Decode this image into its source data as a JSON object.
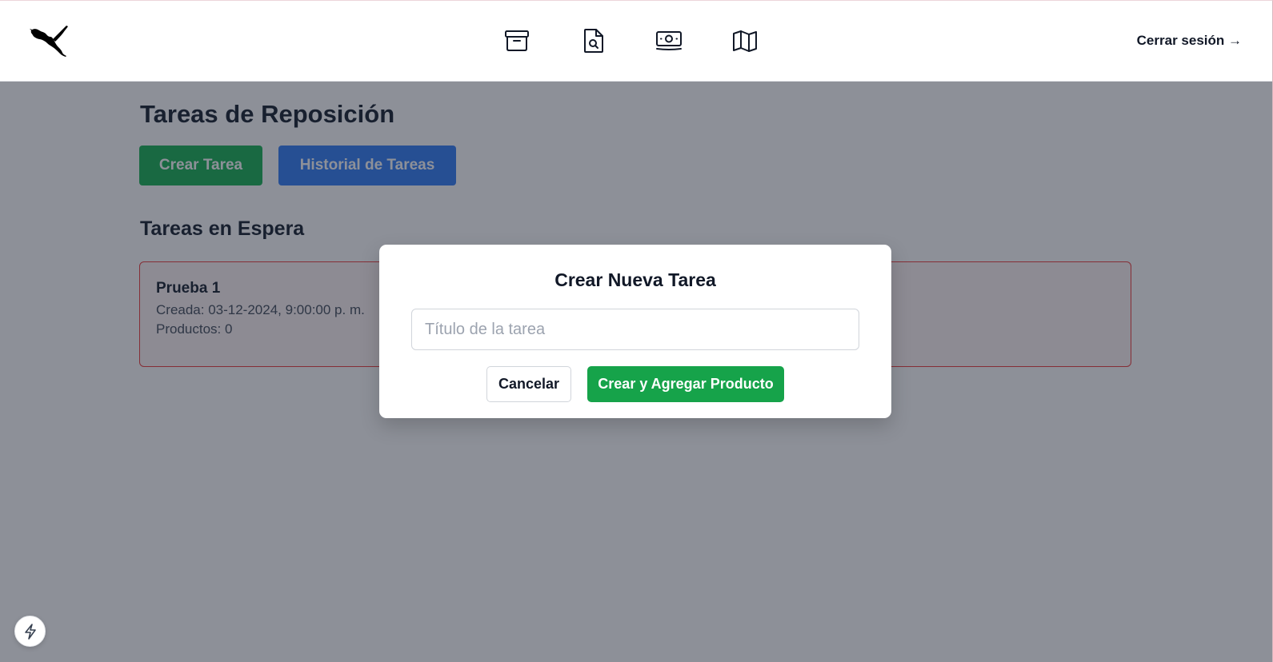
{
  "header": {
    "logo_icon": "puma-logo-icon",
    "nav_icons": [
      "archive-icon",
      "document-search-icon",
      "banknotes-icon",
      "map-icon"
    ],
    "logout_label": "Cerrar sesión →"
  },
  "main": {
    "title": "Tareas de Reposición",
    "create_button_label": "Crear Tarea",
    "history_button_label": "Historial de Tareas",
    "pending_section_title": "Tareas en Espera",
    "tasks": [
      {
        "name": "Prueba 1",
        "created": "Creada: 03-12-2024, 9:00:00 p. m.",
        "products": "Productos: 0"
      }
    ]
  },
  "modal": {
    "title": "Crear Nueva Tarea",
    "input_placeholder": "Título de la tarea",
    "input_value": "",
    "cancel_label": "Cancelar",
    "submit_label": "Crear y Agregar Producto"
  },
  "corner_badge_icon": "lightning-bolt-icon",
  "colors": {
    "create_button": "#22b55a",
    "history_button": "#3b82f6",
    "submit_button": "#16a34a",
    "task_border": "#ef4444"
  }
}
